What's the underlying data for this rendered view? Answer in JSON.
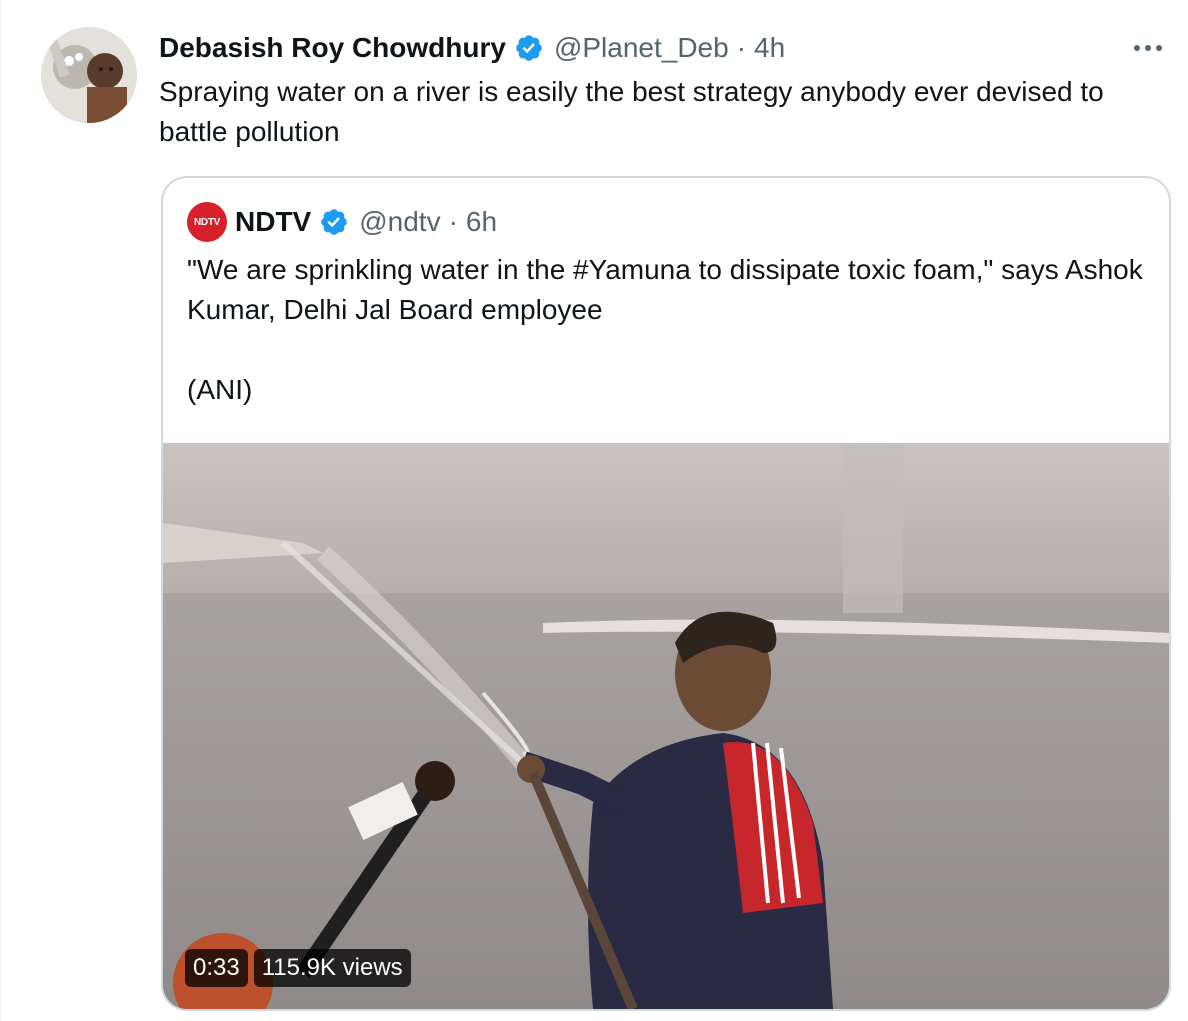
{
  "tweet": {
    "author_name": "Debasish Roy Chowdhury",
    "handle": "@Planet_Deb",
    "separator": "·",
    "time": "4h",
    "text": "Spraying water on a river is easily the best strategy anybody ever devised to battle pollution",
    "more_icon": "more-horizontal-icon",
    "verified_icon": "verified-badge-icon"
  },
  "quoted_tweet": {
    "avatar_text": "NDTV",
    "author_name": "NDTV",
    "handle": "@ndtv",
    "separator": "·",
    "time": "6h",
    "text": "\"We are sprinkling water in the #Yamuna to dissipate toxic foam,\" says Ashok Kumar, Delhi Jal Board employee\n\n(ANI)",
    "video": {
      "duration": "0:33",
      "views": "115.9K views"
    }
  },
  "colors": {
    "verified": "#1d9bf0",
    "secondary_text": "#536471",
    "border": "#cfd9de",
    "ndtv_red": "#d6202a"
  }
}
